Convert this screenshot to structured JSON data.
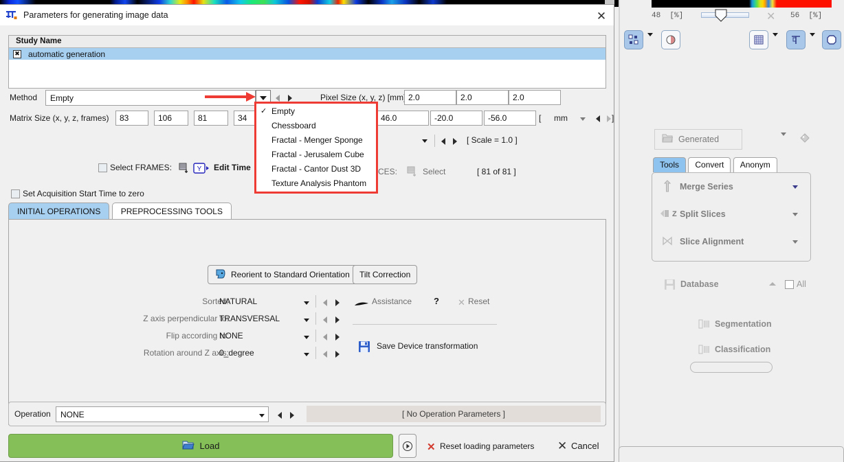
{
  "window": {
    "title": "Parameters for generating image data",
    "app_icon": "pi-tool-icon",
    "close_label": "✕"
  },
  "study": {
    "column_header": "Study Name",
    "rows": [
      {
        "checkbox_glyph": "✖",
        "name": "automatic generation",
        "selected": true
      }
    ]
  },
  "method": {
    "label": "Method",
    "value": "Empty",
    "dropdown_open": true,
    "options": [
      {
        "label": "Empty",
        "checked": true
      },
      {
        "label": "Chessboard",
        "checked": false
      },
      {
        "label": "Fractal - Menger Sponge",
        "checked": false
      },
      {
        "label": "Fractal - Jerusalem Cube",
        "checked": false
      },
      {
        "label": "Fractal - Cantor Dust 3D",
        "checked": false
      },
      {
        "label": "Texture Analysis Phantom",
        "checked": false
      }
    ],
    "check_glyph": "✓",
    "highlight_color": "#ee3b33"
  },
  "pixel_size": {
    "label": "Pixel Size (x, y, z) [mm]",
    "values": [
      "2.0",
      "2.0",
      "2.0"
    ]
  },
  "matrix_size": {
    "label": "Matrix Size (x, y, z, frames)",
    "values": [
      "83",
      "106",
      "81",
      "34"
    ]
  },
  "offset": {
    "values": [
      "46.0",
      "-20.0",
      "-56.0"
    ],
    "unit": "mm",
    "bracket_open": "[",
    "bracket_close": "]"
  },
  "scale": {
    "text": "[ Scale = 1.0 ]"
  },
  "frames": {
    "checkbox_label": "Select FRAMES:",
    "edit_time_label": "Edit Time",
    "edit_time_icon": "edit-time-icon",
    "frames_icon": "frames-icon"
  },
  "slices": {
    "label": "CES:",
    "select_label": "Select",
    "select_icon": "select-slices-icon",
    "count_text": "[ 81 of 81 ]"
  },
  "acq_time": {
    "label": "Set Acquisition Start Time to zero",
    "checked": false
  },
  "tabs": [
    {
      "label": "INITIAL OPERATIONS",
      "active": true
    },
    {
      "label": "PREPROCESSING TOOLS",
      "active": false
    }
  ],
  "initial_operations": {
    "reorient_button": "Reorient to Standard Orientation",
    "reorient_icon": "head-orientation-icon",
    "tilt_button": "Tilt Correction",
    "fields": [
      {
        "label": "Sorted:",
        "value": "NATURAL"
      },
      {
        "label": "Z axis perpendicular to:",
        "value": "TRANSVERSAL"
      },
      {
        "label": "Flip according to:",
        "value": "NONE"
      },
      {
        "label": "Rotation around Z axis:",
        "value": "0_degree"
      }
    ],
    "assistance_label": "Assistance",
    "assistance_icon": "assistance-icon",
    "help_label": "?",
    "reset_label": "Reset",
    "reset_icon": "close-x-icon",
    "save_device_label": "Save Device transformation",
    "save_device_icon": "floppy-save-icon"
  },
  "operation": {
    "label": "Operation",
    "value": "NONE",
    "params_text": "[ No Operation Parameters ]"
  },
  "footer": {
    "load_label": "Load",
    "load_icon": "folder-open-icon",
    "load_color": "#84c057",
    "play_icon": "play-circle-icon",
    "reset_label": "Reset loading parameters",
    "reset_icon": "red-x-icon",
    "cancel_label": "Cancel",
    "cancel_icon": "x-icon"
  },
  "right_panel": {
    "colorbar": {
      "left_value": "48",
      "left_unit": "[%]",
      "right_value": "56",
      "right_unit": "[%]",
      "clear_icon": "x-icon"
    },
    "toolbar_left": [
      {
        "icon": "layout-grid-icon",
        "active": true
      },
      {
        "icon": "chevron-down-icon",
        "active": false
      },
      {
        "icon": "mask-icon",
        "active": false
      }
    ],
    "toolbar_right": [
      {
        "icon": "grid-overlay-icon",
        "active": false
      },
      {
        "icon": "chevron-down-icon",
        "active": false
      },
      {
        "icon": "crosshair-icon",
        "active": true
      },
      {
        "icon": "chevron-down-icon",
        "active": false
      },
      {
        "icon": "polygon-roi-icon",
        "active": true
      }
    ],
    "series_selector": {
      "value": "Generated",
      "icon": "folder-icon",
      "dropdown_icon": "chevron-down-icon",
      "tag_icon": "tag-icon",
      "highlighted": true,
      "highlight_color": "#ee3b33"
    },
    "tabs": [
      {
        "label": "Tools",
        "active": true
      },
      {
        "label": "Convert",
        "active": false
      },
      {
        "label": "Anonym",
        "active": false
      }
    ],
    "tools": [
      {
        "label": "Merge Series",
        "icon": "merge-series-icon"
      },
      {
        "label": "Split Slices",
        "icon": "split-slices-icon"
      },
      {
        "label": "Slice Alignment",
        "icon": "slice-alignment-icon"
      }
    ],
    "database": {
      "label": "Database",
      "icon": "database-save-icon",
      "collapse_icon": "chevron-up-icon",
      "all_label": "All",
      "all_checked": false
    },
    "extras": [
      {
        "label": "Segmentation",
        "icon": "segmentation-icon"
      },
      {
        "label": "Classification",
        "icon": "classification-icon"
      }
    ]
  }
}
